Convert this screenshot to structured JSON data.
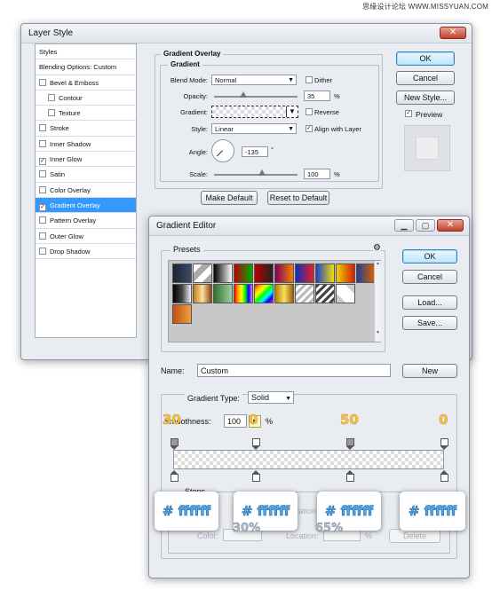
{
  "watermark": "思缘设计论坛 WWW.MISSYUAN.COM",
  "layer_style": {
    "title": "Layer Style",
    "close": "✕",
    "styles_header": "Styles",
    "items": [
      {
        "label": "Blending Options: Custom",
        "checkbox": false,
        "checked": false,
        "selected": false,
        "indent": false
      },
      {
        "label": "Bevel & Emboss",
        "checkbox": true,
        "checked": false,
        "selected": false,
        "indent": false
      },
      {
        "label": "Contour",
        "checkbox": true,
        "checked": false,
        "selected": false,
        "indent": true
      },
      {
        "label": "Texture",
        "checkbox": true,
        "checked": false,
        "selected": false,
        "indent": true
      },
      {
        "label": "Stroke",
        "checkbox": true,
        "checked": false,
        "selected": false,
        "indent": false
      },
      {
        "label": "Inner Shadow",
        "checkbox": true,
        "checked": false,
        "selected": false,
        "indent": false
      },
      {
        "label": "Inner Glow",
        "checkbox": true,
        "checked": true,
        "selected": false,
        "indent": false
      },
      {
        "label": "Satin",
        "checkbox": true,
        "checked": false,
        "selected": false,
        "indent": false
      },
      {
        "label": "Color Overlay",
        "checkbox": true,
        "checked": false,
        "selected": false,
        "indent": false
      },
      {
        "label": "Gradient Overlay",
        "checkbox": true,
        "checked": true,
        "selected": true,
        "indent": false
      },
      {
        "label": "Pattern Overlay",
        "checkbox": true,
        "checked": false,
        "selected": false,
        "indent": false
      },
      {
        "label": "Outer Glow",
        "checkbox": true,
        "checked": false,
        "selected": false,
        "indent": false
      },
      {
        "label": "Drop Shadow",
        "checkbox": true,
        "checked": false,
        "selected": false,
        "indent": false
      }
    ],
    "section_title": "Gradient Overlay",
    "subsection_title": "Gradient",
    "blend_mode_label": "Blend Mode:",
    "blend_mode_value": "Normal",
    "dither_label": "Dither",
    "opacity_label": "Opacity:",
    "opacity_value": "35",
    "opacity_unit": "%",
    "opacity_fraction": 0.35,
    "gradient_label": "Gradient:",
    "reverse_label": "Reverse",
    "style_label": "Style:",
    "style_value": "Linear",
    "align_label": "Align with Layer",
    "align_checked": true,
    "angle_label": "Angle:",
    "angle_value": "-135",
    "angle_unit": "°",
    "scale_label": "Scale:",
    "scale_value": "100",
    "scale_unit": "%",
    "make_default": "Make Default",
    "reset_default": "Reset to Default",
    "ok": "OK",
    "cancel": "Cancel",
    "new_style": "New Style...",
    "preview_label": "Preview",
    "preview_checked": true
  },
  "gradient_editor": {
    "title": "Gradient Editor",
    "presets_label": "Presets",
    "ok": "OK",
    "cancel": "Cancel",
    "load": "Load...",
    "save": "Save...",
    "name_label": "Name:",
    "name_value": "Custom",
    "new_button": "New",
    "gradient_type_label": "Gradient Type:",
    "gradient_type_value": "Solid",
    "smoothness_label": "Smoothness:",
    "smoothness_value": "100",
    "smoothness_unit": "%",
    "stops_label": "Stops",
    "color_label": "Color:",
    "location_label": "Location:",
    "location_unit": "%",
    "delete_label": "Delete",
    "opacity_stop_labels": [
      "30",
      "0",
      "50",
      "0"
    ],
    "color_stop_labels": [
      "# ffffff",
      "# ffffff",
      "# ffffff",
      "# ffffff"
    ],
    "location_annotations": [
      "30%",
      "65%"
    ]
  },
  "colors": {
    "selection": "#3399ff",
    "accent_button": "#bee6fd",
    "annotation_yellow": "#f5c24a",
    "annotation_blue": "#4fa8e8",
    "close_red": "#c0422e"
  }
}
